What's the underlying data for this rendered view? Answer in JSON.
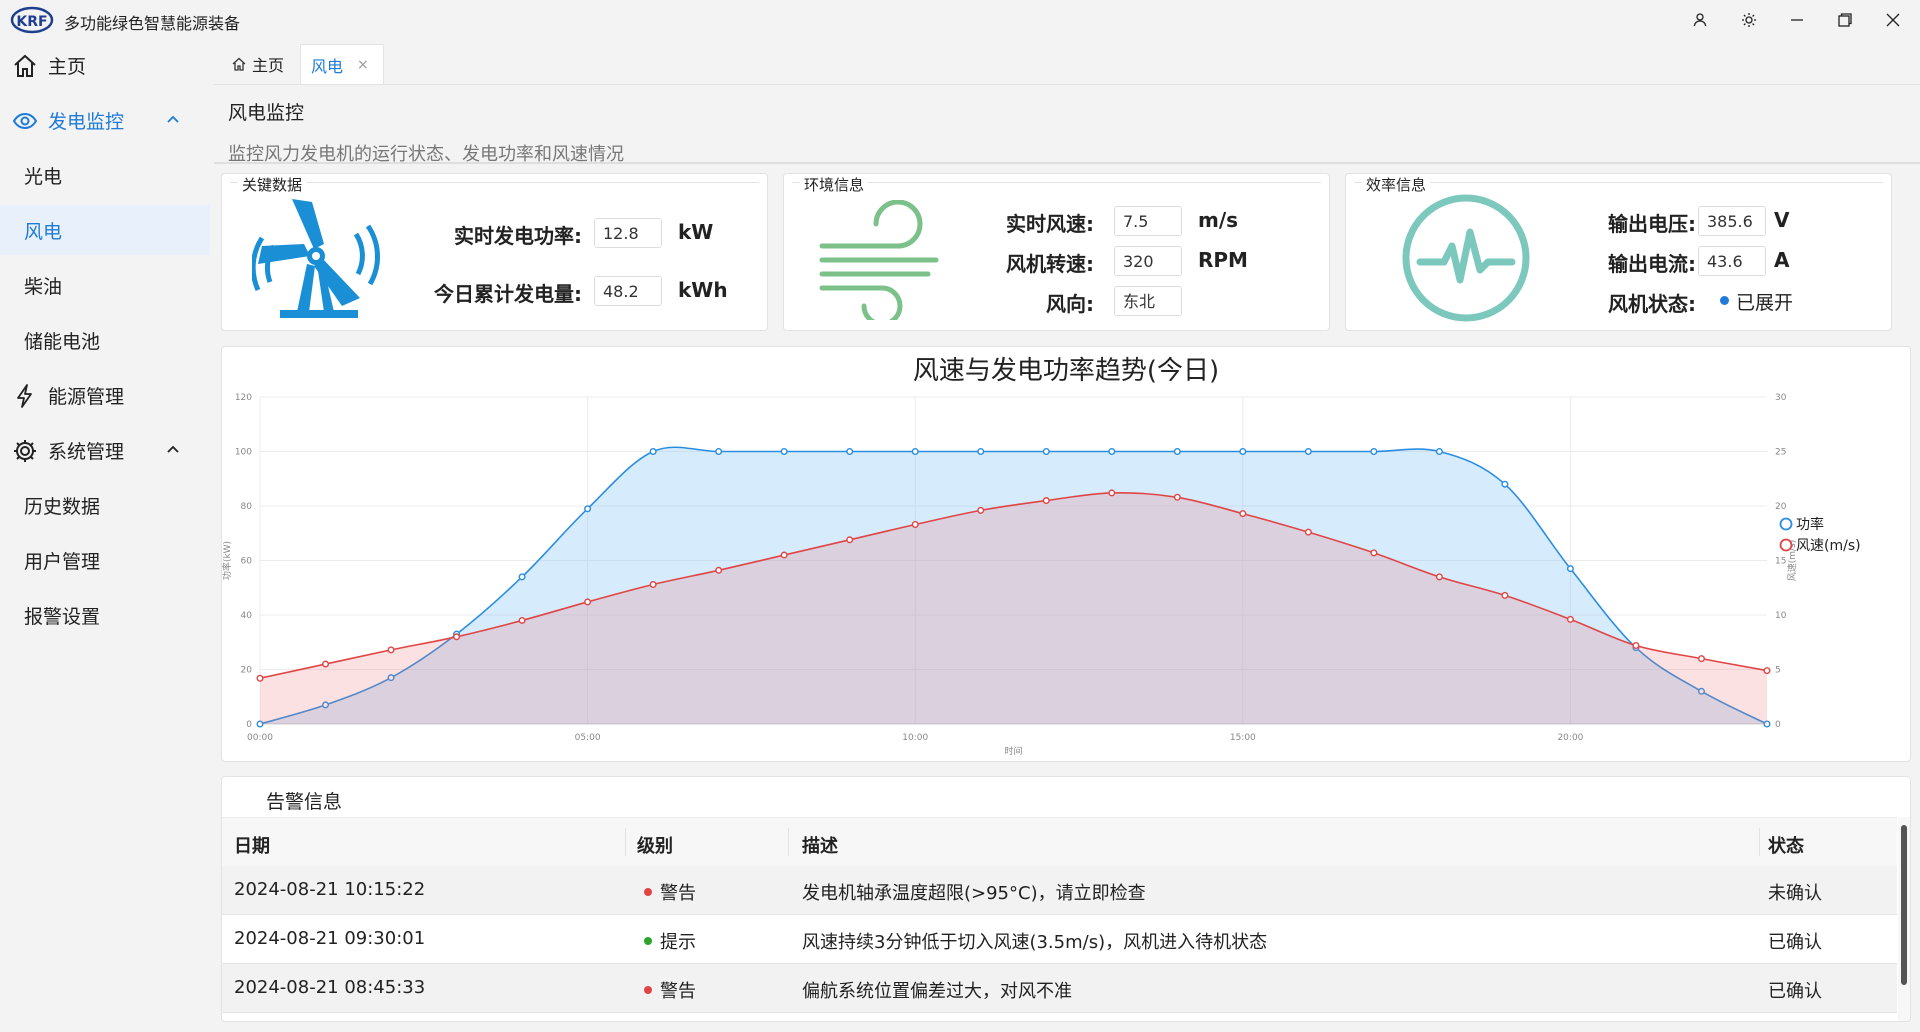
{
  "app": {
    "title": "多功能绿色智慧能源装备",
    "logo_text": "KRF"
  },
  "sidebar": {
    "items": [
      {
        "label": "主页"
      },
      {
        "label": "发电监控"
      },
      {
        "label": "光电"
      },
      {
        "label": "风电"
      },
      {
        "label": "柴油"
      },
      {
        "label": "储能电池"
      },
      {
        "label": "能源管理"
      },
      {
        "label": "系统管理"
      },
      {
        "label": "历史数据"
      },
      {
        "label": "用户管理"
      },
      {
        "label": "报警设置"
      }
    ]
  },
  "tabs": [
    {
      "label": "主页"
    },
    {
      "label": "风电",
      "close": "×"
    }
  ],
  "page": {
    "title": "风电监控",
    "desc": "监控风力发电机的运行状态、发电功率和风速情况"
  },
  "cards": {
    "key": {
      "title": "关键数据",
      "power_label": "实时发电功率:",
      "power_value": "12.8",
      "power_unit": "kW",
      "energy_label": "今日累计发电量:",
      "energy_value": "48.2",
      "energy_unit": "kWh"
    },
    "env": {
      "title": "环境信息",
      "wind_label": "实时风速:",
      "wind_value": "7.5",
      "wind_unit": "m/s",
      "rpm_label": "风机转速:",
      "rpm_value": "320",
      "rpm_unit": "RPM",
      "dir_label": "风向:",
      "dir_value": "东北"
    },
    "eff": {
      "title": "效率信息",
      "volt_label": "输出电压:",
      "volt_value": "385.6",
      "volt_unit": "V",
      "curr_label": "输出电流:",
      "curr_value": "43.6",
      "curr_unit": "A",
      "state_label": "风机状态:",
      "state_value": "已展开"
    }
  },
  "colors": {
    "accent": "#1e7bd8",
    "power": "#2a8de0",
    "wind": "#e04545",
    "ok": "#2ca52c"
  },
  "chart_data": {
    "type": "line",
    "title": "风速与发电功率趋势(今日)",
    "xlabel": "时间",
    "ylabel_left": "功率(kW)",
    "ylabel_right": "风速(m/s)",
    "x_ticks": [
      "00:00",
      "05:00",
      "10:00",
      "15:00",
      "20:00"
    ],
    "y_left_ticks": [
      "0",
      "20",
      "40",
      "60",
      "80",
      "100",
      "120"
    ],
    "y_right_ticks": [
      "0",
      "5",
      "10",
      "15",
      "20",
      "25",
      "30"
    ],
    "x": [
      0,
      1,
      2,
      3,
      4,
      5,
      6,
      7,
      8,
      9,
      10,
      11,
      12,
      13,
      14,
      15,
      16,
      17,
      18,
      19,
      20,
      21,
      22,
      23
    ],
    "xlim": [
      0,
      23
    ],
    "ylim_left": [
      0,
      120
    ],
    "ylim_right": [
      0,
      30
    ],
    "legend_position": "right",
    "series": [
      {
        "name": "功率",
        "axis": "left",
        "values": [
          0,
          7,
          17,
          33,
          54,
          79,
          100,
          100,
          100,
          100,
          100,
          100,
          100,
          100,
          100,
          100,
          100,
          100,
          100,
          88,
          57,
          28,
          12,
          0
        ]
      },
      {
        "name": "风速(m/s)",
        "axis": "right",
        "values": [
          4.2,
          5.5,
          6.8,
          8.0,
          9.5,
          11.2,
          12.8,
          14.1,
          15.5,
          16.9,
          18.3,
          19.6,
          20.5,
          21.2,
          20.8,
          19.3,
          17.6,
          15.7,
          13.5,
          11.8,
          9.6,
          7.2,
          6.0,
          4.9
        ]
      }
    ]
  },
  "alarms": {
    "title": "告警信息",
    "headers": [
      "日期",
      "级别",
      "描述",
      "状态"
    ],
    "rows": [
      {
        "date": "2024-08-21 10:15:22",
        "level": "警告",
        "desc": "发电机轴承温度超限(>95°C)，请立即检查",
        "status": "未确认"
      },
      {
        "date": "2024-08-21 09:30:01",
        "level": "提示",
        "desc": "风速持续3分钟低于切入风速(3.5m/s)，风机进入待机状态",
        "status": "已确认"
      },
      {
        "date": "2024-08-21 08:45:33",
        "level": "警告",
        "desc": "偏航系统位置偏差过大，对风不准",
        "status": "已确认"
      }
    ]
  }
}
